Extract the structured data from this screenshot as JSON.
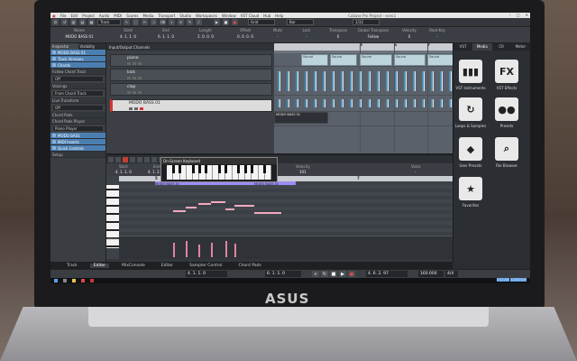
{
  "app": {
    "title": "Cubase Pro Project - ecec1",
    "menu": [
      "File",
      "Edit",
      "Project",
      "Audio",
      "MIDI",
      "Scores",
      "Media",
      "Transport",
      "Studio",
      "Workspaces",
      "Window",
      "VST Cloud",
      "Hub",
      "Help"
    ],
    "window_controls": [
      "–",
      "□",
      "✕"
    ]
  },
  "toolbar": {
    "mode_label": "Track",
    "snap_label": "Grid",
    "quantize_label": "Bar",
    "qvalue_label": "1/32"
  },
  "infoline": {
    "cells": [
      {
        "h": "Name",
        "v": "MODO BASS 01"
      },
      {
        "h": "Start",
        "v": "4. 1. 1. 0"
      },
      {
        "h": "End",
        "v": "6. 1. 1. 0"
      },
      {
        "h": "Length",
        "v": "2. 0. 0. 0"
      },
      {
        "h": "Offset",
        "v": "0. 0. 0. 0"
      },
      {
        "h": "Mute",
        "v": "-"
      },
      {
        "h": "Lock",
        "v": "-"
      },
      {
        "h": "Transpose",
        "v": "0"
      },
      {
        "h": "Global Transpose",
        "v": "Follow"
      },
      {
        "h": "Velocity",
        "v": "0"
      },
      {
        "h": "Root Key",
        "v": "-"
      }
    ]
  },
  "inspector": {
    "tabs": [
      "Inspector",
      "Visibility"
    ],
    "rows": [
      {
        "label": "MODO BASS 01",
        "style": "hl"
      },
      {
        "label": "Track Versions",
        "style": "hl"
      },
      {
        "label": "Chords",
        "style": "hl"
      },
      {
        "label": "Follow Chord Track",
        "style": "sub"
      },
      {
        "label": "Off",
        "style": "field"
      },
      {
        "label": "Voicings",
        "style": "sub"
      },
      {
        "label": "From Chord Track",
        "style": "field"
      },
      {
        "label": "Live Transform",
        "style": "sub"
      },
      {
        "label": "Off",
        "style": "field"
      },
      {
        "label": "Chord Pads",
        "style": "sub"
      },
      {
        "label": "Chord Pads Player",
        "style": "sub"
      },
      {
        "label": "Piano Player",
        "style": "field"
      },
      {
        "label": "MODO BASS",
        "style": "hl"
      },
      {
        "label": "MIDI Inserts",
        "style": "hl"
      },
      {
        "label": "Quick Controls",
        "style": "hl"
      },
      {
        "label": "Setup",
        "style": "sub"
      }
    ]
  },
  "tracklist": {
    "header": "Input/Output Channels",
    "tracks": [
      {
        "num": "",
        "name": "piano"
      },
      {
        "num": "",
        "name": "kick"
      },
      {
        "num": "",
        "name": "clap"
      },
      {
        "num": "",
        "name": "MODO BASS 01"
      }
    ]
  },
  "arrange": {
    "bars": [
      "5",
      "6",
      "7",
      "8",
      "9",
      "10"
    ],
    "piano_events": [
      "Sound",
      "Sound",
      "Sound",
      "Sound",
      "Sound",
      "Sound",
      "Sound",
      "Sound"
    ],
    "bass_event": "MODO BASS 01"
  },
  "media": {
    "tabs": [
      "VST",
      "Media",
      "CR",
      "Meter"
    ],
    "tiles": [
      {
        "icon": "piano-icon",
        "glyph": "▮▮▮",
        "label": "VST Instruments"
      },
      {
        "icon": "fx-icon",
        "glyph": "FX",
        "label": "VST Effects"
      },
      {
        "icon": "loops-icon",
        "glyph": "↻",
        "label": "Loops & Samples"
      },
      {
        "icon": "presets-icon",
        "glyph": "●●",
        "label": "Presets"
      },
      {
        "icon": "user-presets-icon",
        "glyph": "◆",
        "label": "User Presets"
      },
      {
        "icon": "file-browser-icon",
        "glyph": "⌕",
        "label": "File Browser"
      },
      {
        "icon": "favorites-icon",
        "glyph": "★",
        "label": "Favorites"
      }
    ]
  },
  "lower_zone": {
    "info": [
      {
        "h": "Start",
        "v": "4. 1. 1. 0"
      },
      {
        "h": "End",
        "v": "4. 1. 2. 0"
      },
      {
        "h": "Length",
        "v": "0. 0. 1. 0"
      },
      {
        "h": "Pitch",
        "v": "D1"
      },
      {
        "h": "Velocity",
        "v": "101"
      },
      {
        "h": "Voice",
        "v": "-"
      }
    ],
    "keyboard_title": "On-Screen Keyboard",
    "ruler": [
      "5",
      "6",
      "7"
    ],
    "parts": [
      "MODO BASS 01",
      "MODO BASS 01"
    ],
    "velocity_label": "Velocity"
  },
  "bottom_tabs": [
    "Track",
    "Editor",
    "MixConsole",
    "Editor",
    "Sampler Control",
    "Chord Pads"
  ],
  "transport": {
    "left_pos": "4. 1. 1. 0",
    "right_pos": "6. 1. 1. 0",
    "position": "4. 6. 2. 97",
    "tempo": "160.000",
    "signature": "4/4"
  },
  "taskbar": {
    "clock": "4:02 AM",
    "date": "1/28/2019"
  }
}
